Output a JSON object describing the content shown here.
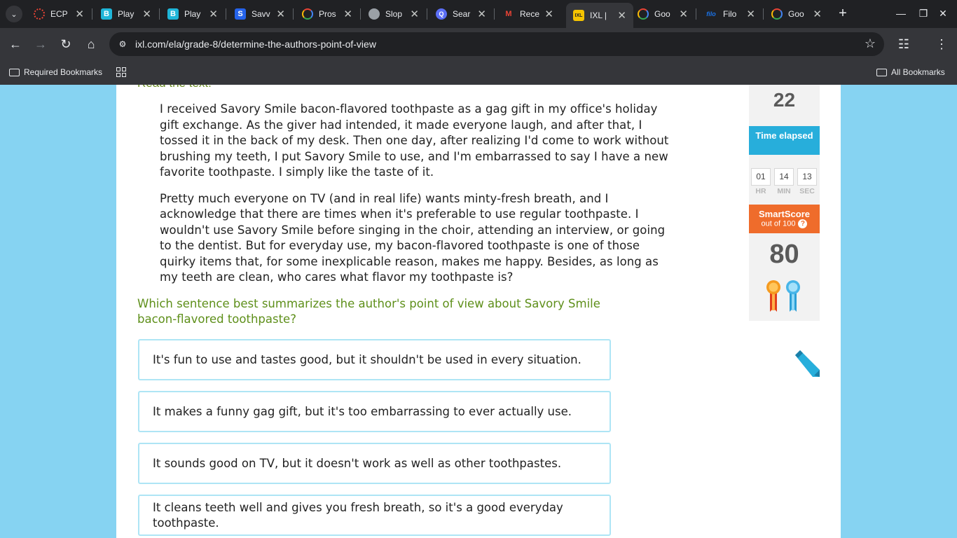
{
  "browser": {
    "tabs": [
      {
        "label": "ECP",
        "icon": "spinner-icon",
        "color": "#ea4335"
      },
      {
        "label": "Play",
        "icon": "blooket-icon",
        "color": "#1fb6d9"
      },
      {
        "label": "Play",
        "icon": "blooket-icon",
        "color": "#1fb6d9"
      },
      {
        "label": "Savv",
        "icon": "savvas-icon",
        "color": "#2563eb"
      },
      {
        "label": "Pros",
        "icon": "google-icon",
        "color": "#4285f4"
      },
      {
        "label": "Slop",
        "icon": "globe-icon",
        "color": "#9aa0a6"
      },
      {
        "label": "Sear",
        "icon": "search-app-icon",
        "color": "#5b6ef5"
      },
      {
        "label": "Rece",
        "icon": "gmail-icon",
        "color": "#ea4335"
      },
      {
        "label": "IXL |",
        "icon": "ixl-icon",
        "color": "#f5c400",
        "active": true
      },
      {
        "label": "Goo",
        "icon": "google-icon",
        "color": "#4285f4"
      },
      {
        "label": "Filo",
        "icon": "filo-icon",
        "color": "#1a73e8"
      },
      {
        "label": "Goo",
        "icon": "google-icon",
        "color": "#4285f4"
      }
    ],
    "url": "ixl.com/ela/grade-8/determine-the-authors-point-of-view",
    "bookmarks": {
      "required": "Required Bookmarks",
      "all": "All Bookmarks"
    }
  },
  "page": {
    "read_label": "Read the text.",
    "passage": [
      "I received Savory Smile bacon-flavored toothpaste as a gag gift in my office's holiday gift exchange. As the giver had intended, it made everyone laugh, and after that, I tossed it in the back of my desk. Then one day, after realizing I'd come to work without brushing my teeth, I put Savory Smile to use, and I'm embarrassed to say I have a new favorite toothpaste. I simply like the taste of it.",
      "Pretty much everyone on TV (and in real life) wants minty-fresh breath, and I acknowledge that there are times when it's preferable to use regular toothpaste. I wouldn't use Savory Smile before singing in the choir, attending an interview, or going to the dentist. But for everyday use, my bacon-flavored toothpaste is one of those quirky items that, for some inexplicable reason, makes me happy. Besides, as long as my teeth are clean, who cares what flavor my toothpaste is?"
    ],
    "question": "Which sentence best summarizes the author's point of view about Savory Smile bacon-flavored toothpaste?",
    "choices": [
      "It's fun to use and tastes good, but it shouldn't be used in every situation.",
      "It makes a funny gag gift, but it's too embarrassing to ever actually use.",
      "It sounds good on TV, but it doesn't work as well as other toothpastes.",
      "It cleans teeth well and gives you fresh breath, so it's a good everyday toothpaste."
    ]
  },
  "sidebar": {
    "questions_answered": "22",
    "time_label": "Time elapsed",
    "timer": {
      "hr": "01",
      "min": "14",
      "sec": "13"
    },
    "timer_units": {
      "hr": "HR",
      "min": "MIN",
      "sec": "SEC"
    },
    "smartscore_title": "SmartScore",
    "smartscore_sub": "out of 100",
    "smartscore": "80",
    "ribbon_colors": [
      "#ef6c2b",
      "#27aedb"
    ]
  }
}
